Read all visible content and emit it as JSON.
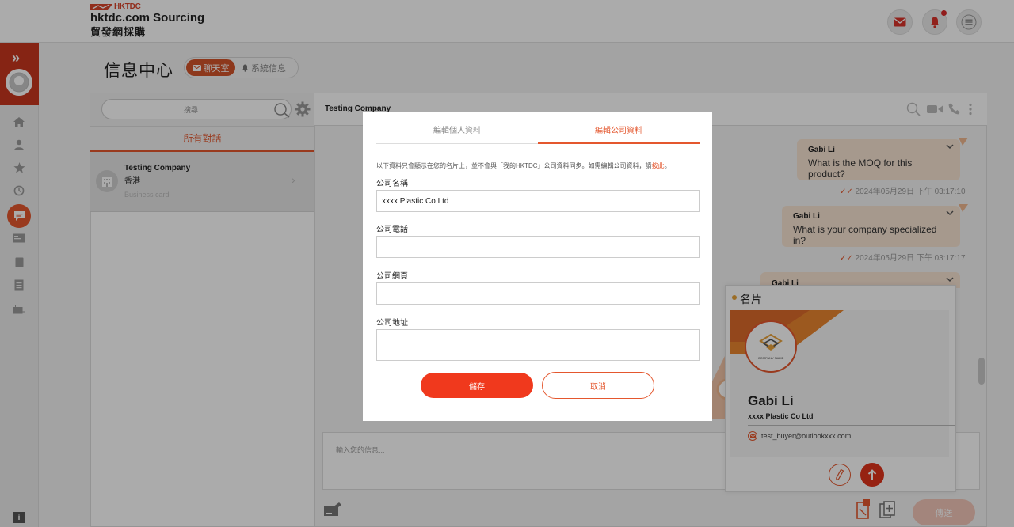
{
  "header": {
    "brand_small": "HKTDC",
    "brand_en": "hktdc.com Sourcing",
    "brand_zh": "貿發網採購"
  },
  "page": {
    "title": "信息中心",
    "tabs": [
      {
        "label": "聊天室",
        "active": true
      },
      {
        "label": "系統信息",
        "active": false
      }
    ]
  },
  "sidebar": {
    "search_placeholder": "搜尋",
    "filter_label": "所有對話",
    "conversations": [
      {
        "name": "Testing Company",
        "region": "香港",
        "last_message": "Business card"
      }
    ]
  },
  "chat": {
    "title": "Testing Company",
    "messages": [
      {
        "sender": "Gabi Li",
        "text": "What is the MOQ for this product?",
        "time": "2024年05月29日 下午 03:17:10"
      },
      {
        "sender": "Gabi Li",
        "text": "What is your company specialized in?",
        "time": "2024年05月29日 下午 03:17:17"
      },
      {
        "sender": "Gabi Li",
        "text": "",
        "time": ""
      }
    ],
    "input_placeholder": "輸入您的信息...",
    "send_label": "傳送"
  },
  "business_card": {
    "title": "名片",
    "name": "Gabi Li",
    "company": "xxxx Plastic Co Ltd",
    "email": "test_buyer@outlookxxx.com",
    "logo_text": "COMPANY NAME"
  },
  "modal": {
    "tabs": [
      "編輯個人資料",
      "編輯公司資料"
    ],
    "active_tab": 1,
    "note": "以下資料只會顯示在您的名片上，並不會與「我的HKTDC」公司資料同步。如需編輯公司資料，請",
    "note_link": "按此",
    "note_end": "。",
    "fields": [
      {
        "label": "公司名稱",
        "value": "xxxx Plastic Co Ltd"
      },
      {
        "label": "公司電話",
        "value": ""
      },
      {
        "label": "公司網頁",
        "value": ""
      },
      {
        "label": "公司地址",
        "value": ""
      }
    ],
    "save_label": "儲存",
    "cancel_label": "取消"
  },
  "colors": {
    "accent": "#e4572e",
    "brand_red": "#c8371f",
    "bubble": "#f8e4d3",
    "primary_button": "#f0391d"
  }
}
